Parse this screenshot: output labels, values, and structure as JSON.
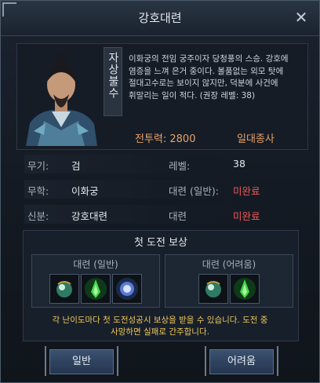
{
  "window": {
    "title": "강호대련"
  },
  "profile": {
    "name": "자상불수",
    "description": "이화궁의 전임 궁주이자 당청풍의 스승. 강호에 염증을 느껴 은거 중이다. 볼품없는 외모 탓에 절대고수로는 보이지 않지만, 덕분에 사건에 휘말리는 일이 적다. (권장 레벨: 38)",
    "power_label": "전투력: 2800",
    "grade": "일대종사"
  },
  "stats": {
    "weapon_label": "무기:",
    "weapon_value": "검",
    "level_label": "레벨:",
    "level_value": "38",
    "martial_label": "무학:",
    "martial_value": "이화궁",
    "duel_normal_label": "대련 (일반):",
    "duel_normal_value": "미완료",
    "identity_label": "신분:",
    "identity_value": "강호대련",
    "duel_label": "대련",
    "duel_value": "미완료"
  },
  "reward": {
    "title": "첫 도전 보상",
    "normal_header": "대련 (일반)",
    "hard_header": "대련 (어려움)",
    "normal_items": [
      "green-orb-icon",
      "green-flame-icon",
      "blue-spirit-icon"
    ],
    "hard_items": [
      "green-orb-icon",
      "green-flame-icon"
    ]
  },
  "notice": {
    "line1": "각 난이도마다 첫 도전성공시 보상을 받을 수 있습니다. 도전 중",
    "line2": "사망하면 실패로 간주합니다."
  },
  "buttons": {
    "normal": "일반",
    "hard": "어려움"
  },
  "colors": {
    "accent": "#e7a26a",
    "incomplete": "#f25757",
    "notice": "#f0c85a"
  }
}
